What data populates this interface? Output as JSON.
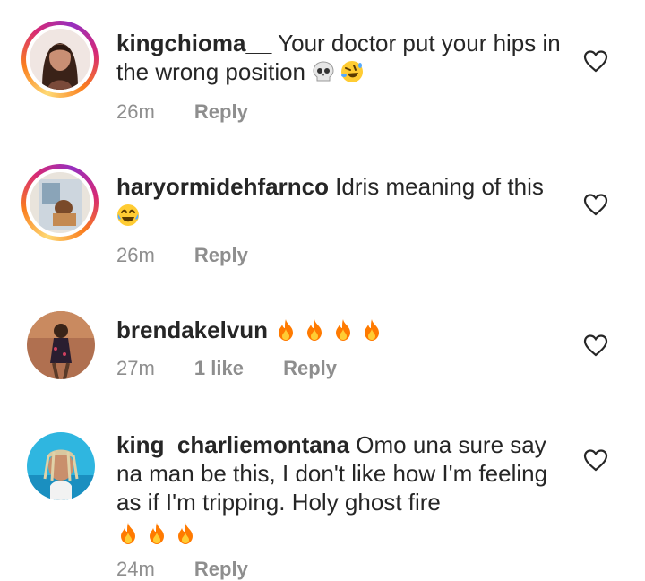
{
  "comments": [
    {
      "username": "kingchioma__",
      "text": " Your doctor put your hips in the wrong position ",
      "emoji": [
        "skull",
        "rolling-on-floor-laughing"
      ],
      "time": "26m",
      "likes": "",
      "reply": "Reply"
    },
    {
      "username": "haryormidehfarnco",
      "text": " Idris meaning of this ",
      "emoji": [
        "face-with-tears-of-joy"
      ],
      "time": "26m",
      "likes": "",
      "reply": "Reply"
    },
    {
      "username": "brendakelvun",
      "text": " ",
      "emoji": [
        "fire",
        "fire",
        "fire",
        "fire"
      ],
      "time": "27m",
      "likes": "1 like",
      "reply": "Reply"
    },
    {
      "username": "king_charliemontana",
      "text": " Omo una sure say na man be this, I don't like how I'm feeling as if I'm tripping. Holy ghost fire",
      "emoji": [
        "fire",
        "fire",
        "fire"
      ],
      "time": "24m",
      "likes": "",
      "reply": "Reply"
    }
  ],
  "colors": {
    "text": "#262626",
    "meta": "#8e8e8e",
    "fire": "#ff7a00",
    "story_ring": "#d62976"
  },
  "icons": {
    "like": "heart-outline-icon"
  }
}
